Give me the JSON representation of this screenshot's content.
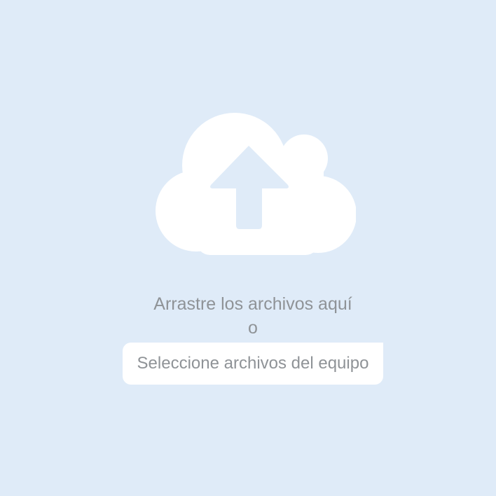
{
  "upload": {
    "icon": "cloud-upload-icon",
    "drag_prompt": "Arrastre los archivos aquí",
    "or_label": "o",
    "select_button_label": "Seleccione archivos del equipo"
  },
  "colors": {
    "background": "#dfebf8",
    "icon_fill": "#ffffff",
    "text": "#8f9397",
    "button_background": "#ffffff"
  }
}
